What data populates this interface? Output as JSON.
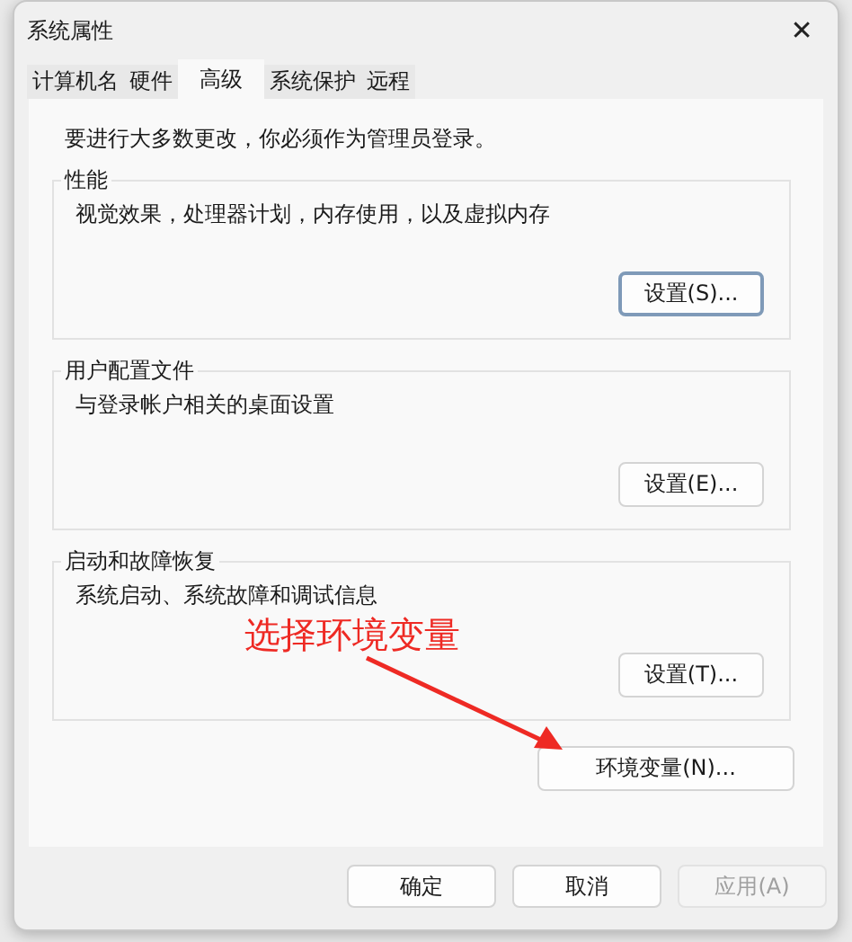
{
  "window": {
    "title": "系统属性",
    "close": "✕"
  },
  "tabs": [
    {
      "label": "计算机名",
      "selected": false
    },
    {
      "label": "硬件",
      "selected": false
    },
    {
      "label": "高级",
      "selected": true
    },
    {
      "label": "系统保护",
      "selected": false
    },
    {
      "label": "远程",
      "selected": false
    }
  ],
  "notice": "要进行大多数更改，你必须作为管理员登录。",
  "groups": [
    {
      "title": "性能",
      "description": "视觉效果，处理器计划，内存使用，以及虚拟内存",
      "button": {
        "label": "设置(S)...",
        "focused": true
      }
    },
    {
      "title": "用户配置文件",
      "description": "与登录帐户相关的桌面设置",
      "button": {
        "label": "设置(E)...",
        "focused": false
      }
    },
    {
      "title": "启动和故障恢复",
      "description": "系统启动、系统故障和调试信息",
      "button": {
        "label": "设置(T)...",
        "focused": false
      }
    }
  ],
  "env_button": "环境变量(N)...",
  "annotation": {
    "text": "选择环境变量"
  },
  "buttons": [
    {
      "label": "确定",
      "disabled": false
    },
    {
      "label": "取消",
      "disabled": false
    },
    {
      "label": "应用(A)",
      "disabled": true
    }
  ]
}
